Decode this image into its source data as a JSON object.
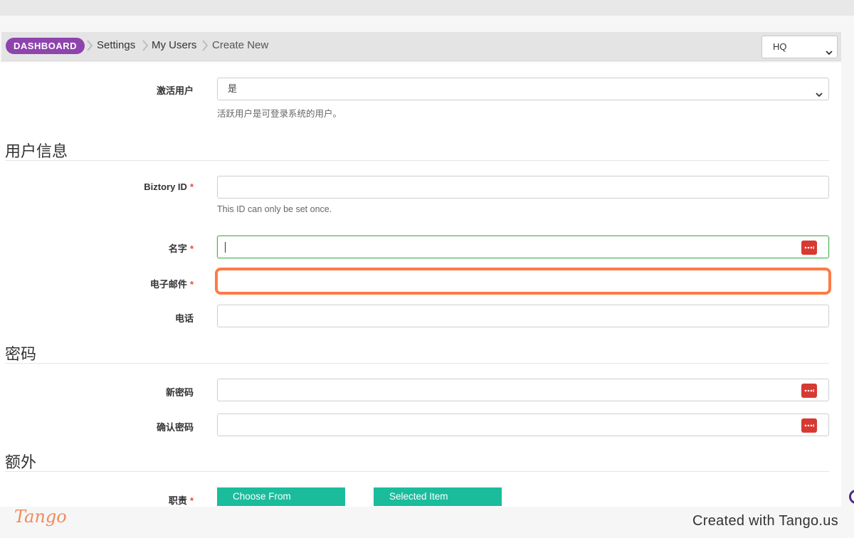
{
  "breadcrumb": {
    "dashboard": "DASHBOARD",
    "items": [
      "Settings",
      "My Users",
      "Create New"
    ]
  },
  "location_select": {
    "value": "HQ"
  },
  "form": {
    "active_user": {
      "label": "激活用户",
      "value": "是",
      "help": "活跃用户是可登录系统的用户。"
    },
    "section_user_info": "用户信息",
    "biztory_id": {
      "label": "Biztory ID",
      "required_mark": "*",
      "help": "This ID can only be set once.",
      "value": ""
    },
    "name": {
      "label": "名字",
      "required_mark": "*",
      "value": ""
    },
    "email": {
      "label": "电子邮件",
      "required_mark": "*",
      "value": ""
    },
    "phone": {
      "label": "电话",
      "value": ""
    },
    "section_password": "密码",
    "new_password": {
      "label": "新密码",
      "value": ""
    },
    "confirm_password": {
      "label": "确认密码",
      "value": ""
    },
    "section_extra": "额外",
    "roles": {
      "label": "职责",
      "required_mark": "*",
      "choose_from": "Choose From",
      "selected_item": "Selected Item"
    }
  },
  "icons": {
    "password_manager": "password-dots-icon",
    "dropdown": "chevron-down-icon",
    "breadcrumb_separator": "chevron-right-icon"
  },
  "colors": {
    "dashboard_pill": "#8e44ad",
    "accent_teal": "#1abc9c",
    "required": "#e74c3c",
    "highlight": "#ff7a45",
    "password_badge": "#d63a32"
  },
  "footer": {
    "logo": "Tango",
    "credit": "Created with Tango.us"
  }
}
